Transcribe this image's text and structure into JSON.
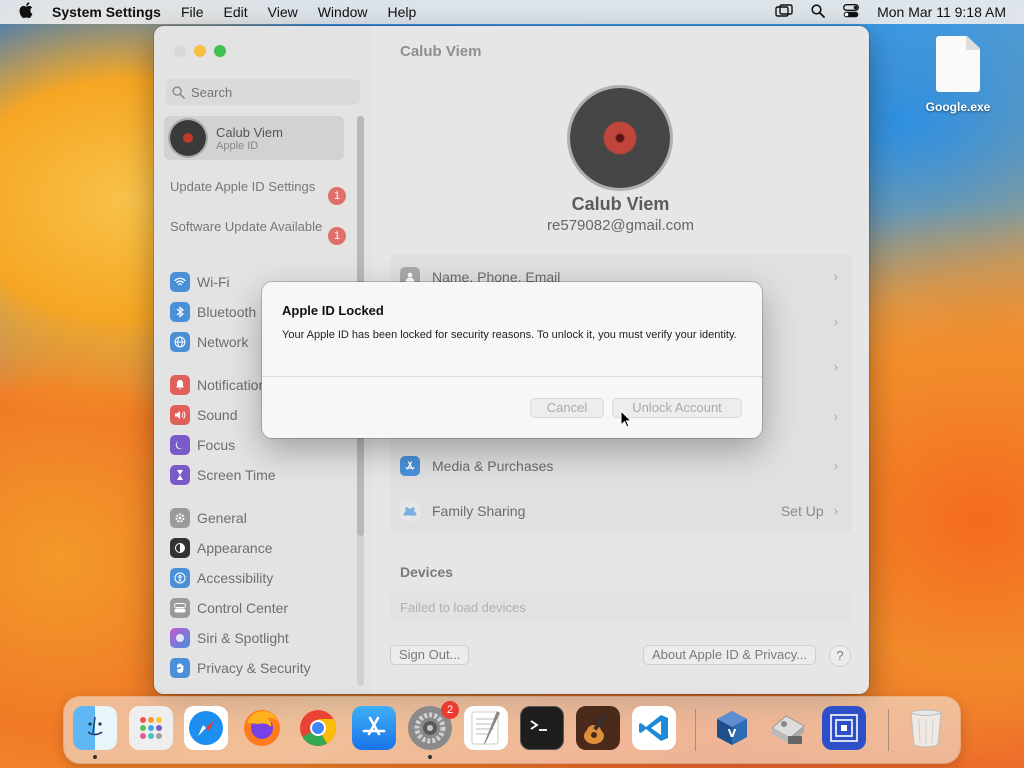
{
  "menubar": {
    "app_name": "System Settings",
    "menus": [
      "File",
      "Edit",
      "View",
      "Window",
      "Help"
    ],
    "clock": "Mon Mar 11  9:18 AM"
  },
  "desktop": {
    "file_label": "Google.exe"
  },
  "sidebar": {
    "search_placeholder": "Search",
    "profile": {
      "name": "Calub Viem",
      "subtitle": "Apple ID"
    },
    "notices": [
      {
        "label": "Update Apple ID Settings",
        "badge": "1"
      },
      {
        "label": "Software Update Available",
        "badge": "1"
      }
    ],
    "items": [
      {
        "label": "Wi-Fi",
        "color": "#4a90d9"
      },
      {
        "label": "Bluetooth",
        "color": "#4a90d9"
      },
      {
        "label": "Network",
        "color": "#4a90d9"
      },
      {
        "label": "Notifications",
        "color": "#e0605a"
      },
      {
        "label": "Sound",
        "color": "#e0605a"
      },
      {
        "label": "Focus",
        "color": "#7a5ac8"
      },
      {
        "label": "Screen Time",
        "color": "#7a5ac8"
      },
      {
        "label": "General",
        "color": "#9a9a9a"
      },
      {
        "label": "Appearance",
        "color": "#333333"
      },
      {
        "label": "Accessibility",
        "color": "#4a90d9"
      },
      {
        "label": "Control Center",
        "color": "#9a9a9a"
      },
      {
        "label": "Siri & Spotlight",
        "color": "#c05ad0"
      },
      {
        "label": "Privacy & Security",
        "color": "#4a90d9"
      }
    ]
  },
  "main": {
    "title": "Calub Viem",
    "name": "Calub Viem",
    "email": "re579082@gmail.com",
    "rows": [
      {
        "label": "Name, Phone, Email"
      },
      {
        "label": ""
      },
      {
        "label": ""
      },
      {
        "label": ""
      },
      {
        "label": "Media & Purchases"
      },
      {
        "label": "Family Sharing",
        "value": "Set Up"
      }
    ],
    "devices_title": "Devices",
    "devices_status": "Failed to load devices",
    "sign_out": "Sign Out...",
    "about": "About Apple ID & Privacy...",
    "help": "?"
  },
  "dialog": {
    "title": "Apple ID Locked",
    "message": "Your Apple ID has been locked for security reasons. To unlock it, you must verify your identity.",
    "cancel": "Cancel",
    "unlock": "Unlock Account"
  },
  "dock": {
    "settings_badge": "2",
    "apps": [
      "finder-icon",
      "launchpad-icon",
      "safari-icon",
      "firefox-icon",
      "chrome-icon",
      "app-store-icon",
      "system-settings-icon",
      "textedit-icon",
      "terminal-icon",
      "garageband-icon",
      "vscode-icon",
      "virtualbox-icon",
      "disk-utility-icon",
      "qemu-icon",
      "trash-icon"
    ]
  }
}
